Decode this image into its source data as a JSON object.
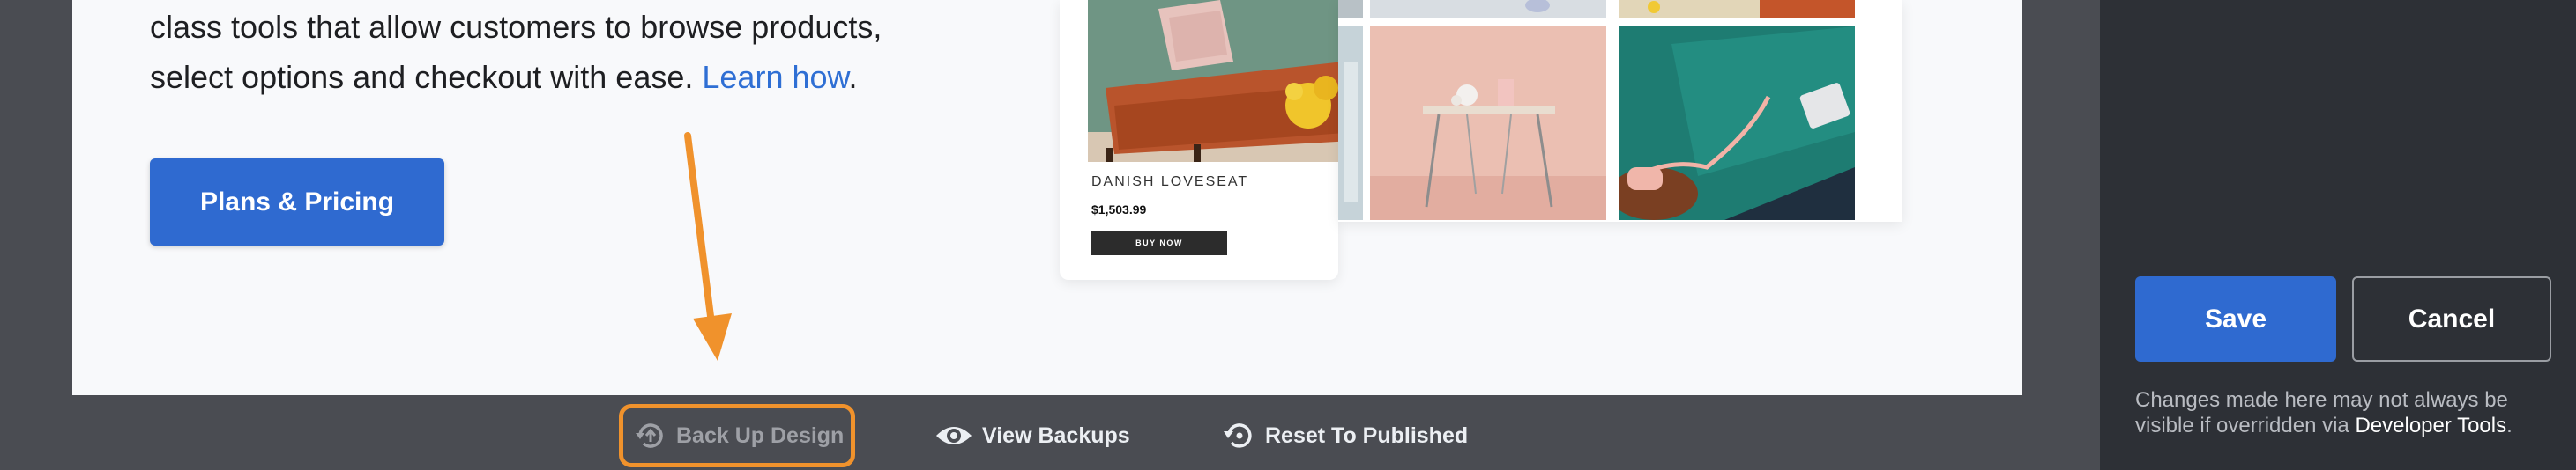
{
  "preview": {
    "intro_line1": "class tools that allow customers to browse products,",
    "intro_line2": "select options and checkout with ease. ",
    "learn_link": "Learn how",
    "intro_end": ".",
    "plans_button": "Plans & Pricing",
    "product": {
      "name": "DANISH LOVESEAT",
      "price": "$1,503.99",
      "buy_label": "BUY NOW"
    }
  },
  "toolbar": {
    "backup_label": "Back Up Design",
    "view_backups_label": "View Backups",
    "reset_label": "Reset To Published"
  },
  "sidebar": {
    "save_label": "Save",
    "cancel_label": "Cancel",
    "note_text": "Changes made here may not always be visible if overridden via ",
    "note_link": "Developer Tools",
    "note_end": "."
  },
  "colors": {
    "accent": "#2f6ad0",
    "highlight": "#f0922c",
    "link": "#2f6fd4"
  },
  "icons": [
    "backup-icon",
    "eye-icon",
    "reset-icon",
    "arrow-annotation"
  ]
}
